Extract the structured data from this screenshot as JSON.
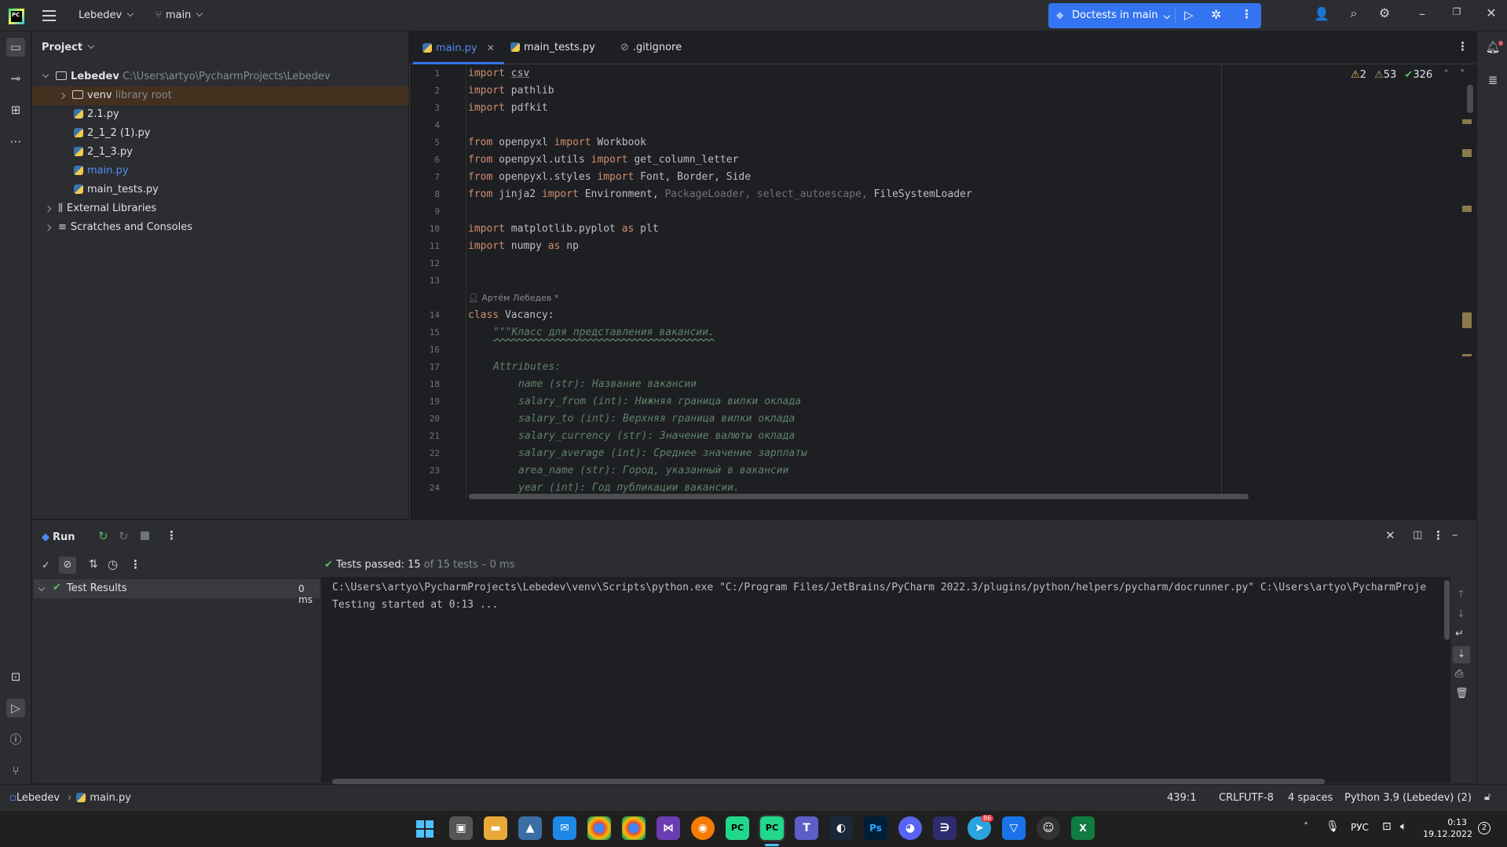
{
  "topbar": {
    "logo_text": "PC",
    "project_name": "Lebedev",
    "branch": "main",
    "run_config": "Doctests in main"
  },
  "project_panel": {
    "title": "Project",
    "root": {
      "name": "Lebedev",
      "path": "C:\\Users\\artyo\\PycharmProjects\\Lebedev"
    },
    "items": [
      {
        "name": "venv",
        "note": "library root"
      },
      {
        "name": "2.1.py"
      },
      {
        "name": "2_1_2 (1).py"
      },
      {
        "name": "2_1_3.py"
      },
      {
        "name": "main.py"
      },
      {
        "name": "main_tests.py"
      },
      {
        "name": "External Libraries"
      },
      {
        "name": "Scratches and Consoles"
      }
    ]
  },
  "editor": {
    "tabs": [
      {
        "label": "main.py"
      },
      {
        "label": "main_tests.py"
      },
      {
        "label": ".gitignore"
      }
    ],
    "inspections": {
      "warnings": "2",
      "weak_warnings": "53",
      "ok": "326"
    },
    "line_numbers": [
      "1",
      "2",
      "3",
      "4",
      "5",
      "6",
      "7",
      "8",
      "9",
      "10",
      "11",
      "12",
      "13",
      "14",
      "15",
      "16",
      "17",
      "18",
      "19",
      "20",
      "21",
      "22",
      "23",
      "24"
    ],
    "author_hint": "Артём Лебедев *",
    "code": {
      "l1_kw": "import",
      "l1_id": "csv",
      "l2_kw": "import",
      "l2_id": "pathlib",
      "l3_kw": "import",
      "l3_id": "pdfkit",
      "l5_kw1": "from",
      "l5_id1": "openpyxl",
      "l5_kw2": "import",
      "l5_id2": "Workbook",
      "l6_kw1": "from",
      "l6_id1": "openpyxl.utils",
      "l6_kw2": "import",
      "l6_id2": "get_column_letter",
      "l7_kw1": "from",
      "l7_id1": "openpyxl.styles",
      "l7_kw2": "import",
      "l7_id2": "Font, Border, Side",
      "l8_kw1": "from",
      "l8_id1": "jinja2",
      "l8_kw2": "import",
      "l8_id2": "Environment,",
      "l8_dim": "PackageLoader, select_autoescape,",
      "l8_id3": "FileSystemLoader",
      "l10_kw1": "import",
      "l10_id1": "matplotlib.pyplot",
      "l10_kw2": "as",
      "l10_id2": "plt",
      "l11_kw1": "import",
      "l11_id1": "numpy",
      "l11_kw2": "as",
      "l11_id2": "np",
      "l14_kw": "class",
      "l14_id": "Vacancy:",
      "l15": "\"\"\"Класс для представления вакансии.",
      "l17": "Attributes:",
      "l18": "name (str): Название вакансии",
      "l19": "salary_from (int): Нижняя граница вилки оклада",
      "l20": "salary_to (int): Верхняя граница вилки оклада",
      "l21": "salary_currency (str): Значение валюты оклада",
      "l22": "salary_average (int): Среднее значение зарплаты",
      "l23": "area_name (str): Город, указанный в вакансии",
      "l24": "year (int): Год публикации вакансии."
    }
  },
  "run_panel": {
    "tab_label": "Run",
    "tests_passed_label": "Tests passed:",
    "tests_passed_count": "15",
    "tests_total": "of 15 tests – 0 ms",
    "test_results_label": "Test Results",
    "test_results_time": "0 ms",
    "console_line1": "C:\\Users\\artyo\\PycharmProjects\\Lebedev\\venv\\Scripts\\python.exe \"C:/Program Files/JetBrains/PyCharm 2022.3/plugins/python/helpers/pycharm/docrunner.py\" C:\\Users\\artyo\\PycharmProje",
    "console_line2": "Testing started at 0:13 ..."
  },
  "statusbar": {
    "breadcrumb_project": "Lebedev",
    "breadcrumb_file": "main.py",
    "position": "439:1",
    "line_sep": "CRLF",
    "encoding": "UTF-8",
    "indent": "4 spaces",
    "interpreter": "Python 3.9 (Lebedev) (2)"
  },
  "taskbar": {
    "apps": [
      "Ps"
    ],
    "telegram_badge": "86",
    "lang": "РУС",
    "time": "0:13",
    "date": "19.12.2022",
    "notif_count": "2"
  },
  "colors": {
    "accent": "#3574f0",
    "bg": "#1e1f22",
    "panel": "#2b2d30",
    "keyword": "#cf8e6d",
    "docstring": "#5f826b",
    "success": "#5fb865"
  }
}
